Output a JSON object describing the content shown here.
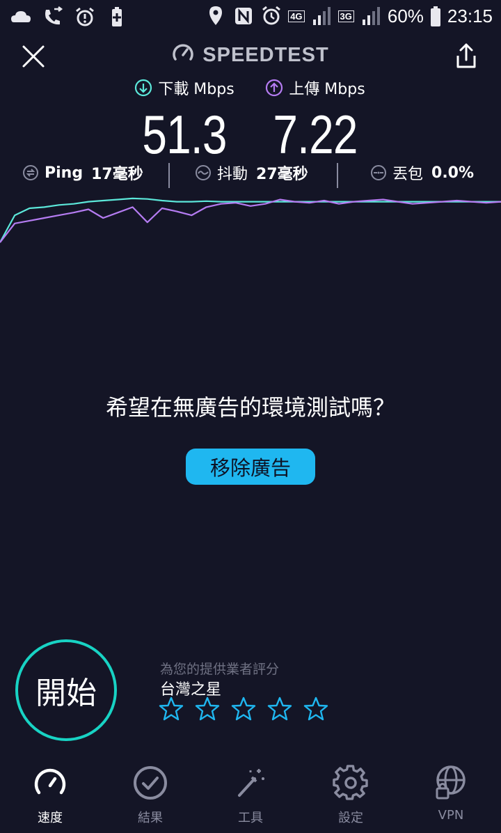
{
  "status_bar": {
    "battery": "60%",
    "time": "23:15",
    "net_4g": "4G",
    "net_3g": "3G"
  },
  "header": {
    "brand": "SPEEDTEST"
  },
  "download": {
    "label": "下載 Mbps",
    "value": "51.3"
  },
  "upload": {
    "label": "上傳 Mbps",
    "value": "7.22"
  },
  "stats": {
    "ping": {
      "label": "Ping",
      "value": "17毫秒"
    },
    "jitter": {
      "label": "抖動",
      "value": "27毫秒"
    },
    "loss": {
      "label": "丟包",
      "value": "0.0%"
    }
  },
  "chart_data": {
    "type": "line",
    "series": [
      {
        "values": [
          0.05,
          0.55,
          0.68,
          0.7,
          0.74,
          0.76,
          0.8,
          0.82,
          0.84,
          0.86,
          0.85,
          0.82,
          0.8,
          0.8,
          0.81,
          0.8,
          0.8,
          0.8,
          0.8,
          0.8,
          0.8,
          0.8,
          0.8,
          0.8,
          0.8,
          0.8,
          0.8,
          0.8,
          0.8,
          0.8,
          0.8,
          0.8,
          0.8,
          0.8,
          0.8
        ]
      },
      {
        "values": [
          0.05,
          0.4,
          0.45,
          0.5,
          0.55,
          0.6,
          0.66,
          0.5,
          0.6,
          0.7,
          0.42,
          0.68,
          0.62,
          0.55,
          0.7,
          0.76,
          0.78,
          0.72,
          0.76,
          0.84,
          0.8,
          0.78,
          0.82,
          0.76,
          0.8,
          0.82,
          0.84,
          0.8,
          0.76,
          0.78,
          0.8,
          0.82,
          0.8,
          0.78,
          0.8
        ]
      }
    ],
    "colors": [
      "#5ce8da",
      "#b57cf2"
    ]
  },
  "ad": {
    "prompt": "希望在無廣告的環境測試嗎？",
    "remove_label": "移除廣告"
  },
  "start": {
    "label": "開始"
  },
  "provider": {
    "rate_hint": "為您的提供業者評分",
    "name": "台灣之星",
    "rating": 0,
    "max_rating": 5
  },
  "nav": [
    {
      "label": "速度",
      "icon": "speedometer-icon",
      "active": true
    },
    {
      "label": "結果",
      "icon": "check-circle-icon",
      "active": false
    },
    {
      "label": "工具",
      "icon": "magic-wand-icon",
      "active": false
    },
    {
      "label": "設定",
      "icon": "gear-icon",
      "active": false
    },
    {
      "label": "VPN",
      "icon": "globe-lock-icon",
      "active": false
    }
  ],
  "colors": {
    "background": "#141526",
    "accent_cyan": "#18d3c4",
    "accent_purple": "#b57cf2",
    "button_blue": "#1fb7f0",
    "star_blue": "#1fb7f0"
  }
}
